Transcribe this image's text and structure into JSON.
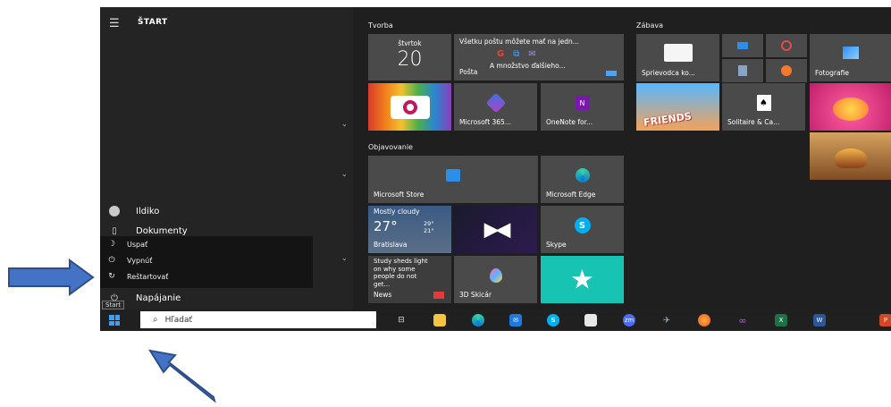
{
  "start": {
    "title": "ŠTART",
    "menu_icon": "hamburger-icon",
    "tooltip": "Start",
    "sidebar": {
      "user": "Ildiko",
      "documents": "Dokumenty",
      "power": "Napájanie"
    },
    "power_menu": {
      "sleep": "Uspať",
      "shutdown": "Vypnúť",
      "restart": "Reštartovať"
    }
  },
  "groups": {
    "tvorba": "Tvorba",
    "zabava": "Zábava",
    "objavovanie": "Objavovanie"
  },
  "tiles": {
    "calendar_day": "štvrtok",
    "calendar_date": "20",
    "mail_text": "Všetku poštu môžete mať na jedn...",
    "mail_more": "A množstvo ďalšieho...",
    "mail_label": "Pošta",
    "m365": "Microsoft 365...",
    "onenote": "OneNote for...",
    "store": "Microsoft Store",
    "edge": "Microsoft Edge",
    "weather_cond": "Mostly cloudy",
    "weather_temp": "27°",
    "weather_high": "29°",
    "weather_low": "21°",
    "weather_city": "Bratislava",
    "skype": "Skype",
    "news_text": "Study sheds light on why some people do not get...",
    "news_label": "News",
    "paint3d": "3D Skicár",
    "xbox_guide": "Sprievodca ko...",
    "photos": "Fotografie",
    "solitaire": "Solitaire & Ca...",
    "candy_friends": "FRIENDS"
  },
  "taskbar": {
    "search_placeholder": "Hľadať",
    "zoom_label": "zm"
  },
  "colors": {
    "accent": "#0078d7",
    "arrow": "#4472c4",
    "arrow_border": "#2f4e8a"
  }
}
